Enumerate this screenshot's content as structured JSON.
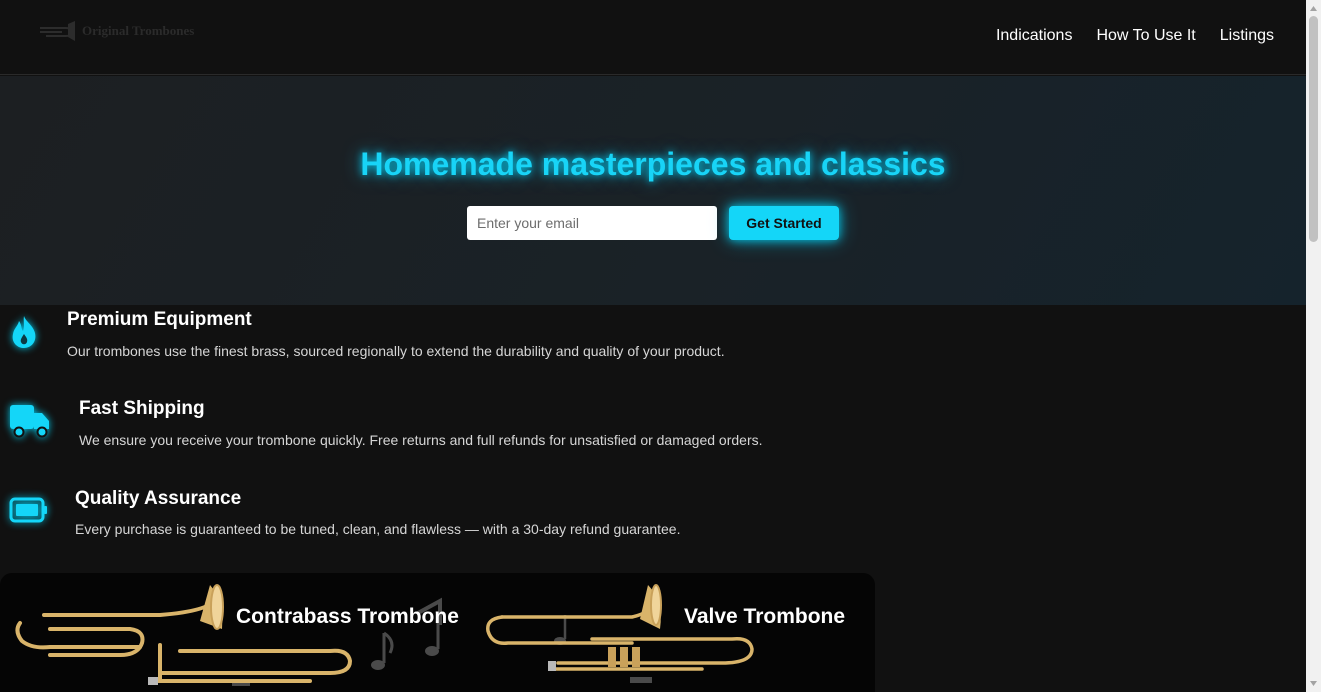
{
  "header": {
    "logo_text": "Original Trombones",
    "nav": [
      {
        "label": "Indications"
      },
      {
        "label": "How To Use It"
      },
      {
        "label": "Listings"
      }
    ]
  },
  "hero": {
    "title": "Homemade masterpieces and classics",
    "email_placeholder": "Enter your email",
    "cta_label": "Get Started"
  },
  "features": [
    {
      "icon": "flame-icon",
      "title": "Premium Equipment",
      "description": "Our trombones use the finest brass, sourced regionally to extend the durability and quality of your product."
    },
    {
      "icon": "truck-icon",
      "title": "Fast Shipping",
      "description": "We ensure you receive your trombone quickly. Free returns and full refunds for unsatisfied or damaged orders."
    },
    {
      "icon": "battery-icon",
      "title": "Quality Assurance",
      "description": "Every purchase is guaranteed to be tuned, clean, and flawless — with a 30-day refund guarantee."
    }
  ],
  "banner": {
    "items": [
      {
        "label": "Contrabass Trombone"
      },
      {
        "label": "Valve Trombone"
      }
    ]
  },
  "colors": {
    "accent": "#14d6f8",
    "background": "#111111",
    "hero_bg": "#1a2227",
    "brass": "#d9b46a"
  }
}
